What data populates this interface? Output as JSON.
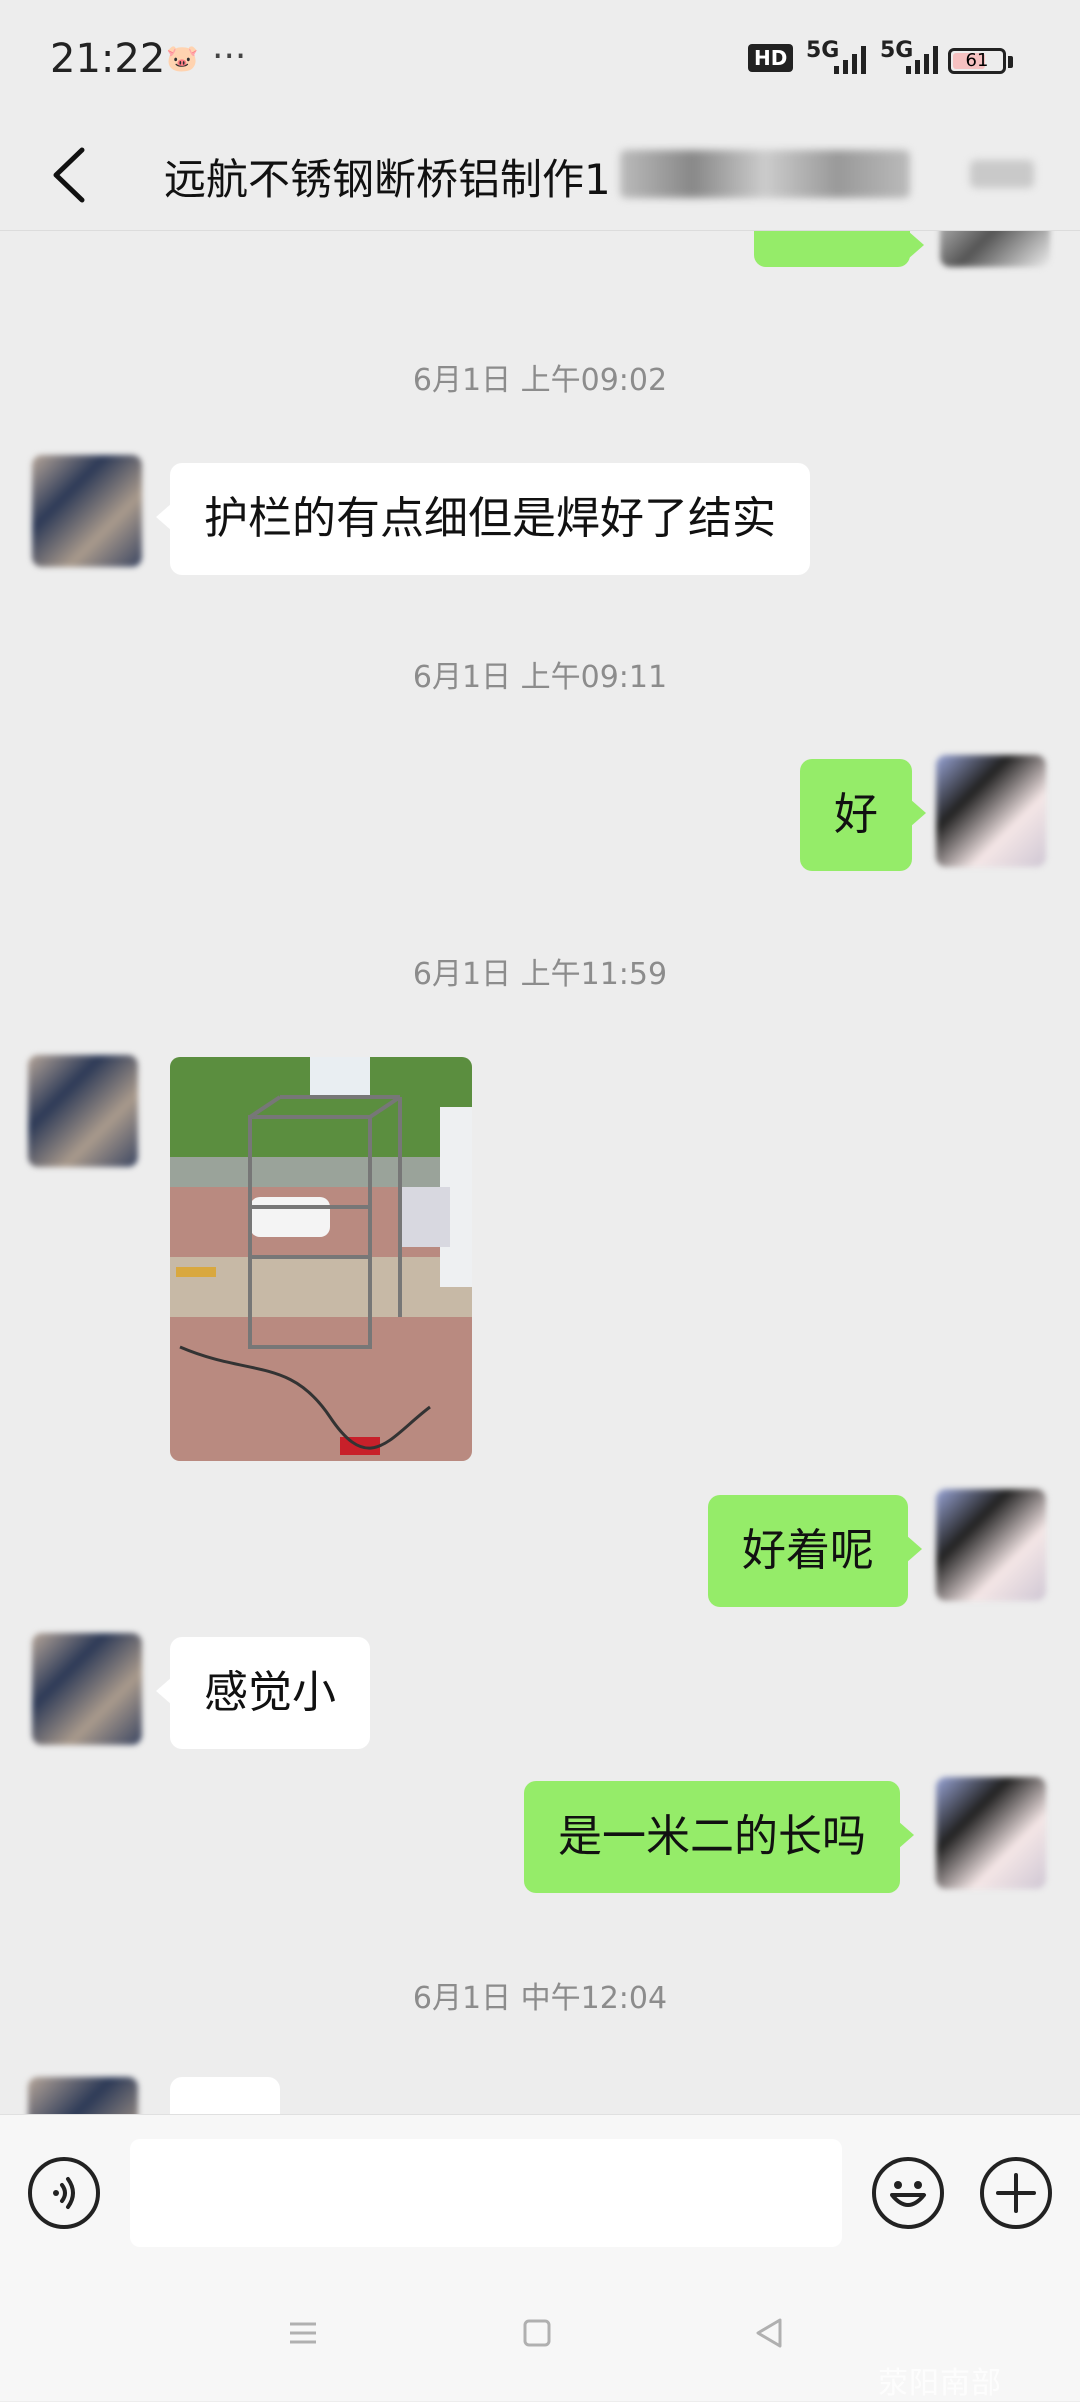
{
  "status_bar": {
    "time": "21:22",
    "hd_label": "HD",
    "net1": "5G",
    "net2": "5G",
    "battery": "61",
    "battery_level": 0.61
  },
  "header": {
    "title": "远航不锈钢断桥铝制作",
    "title_tail_redacted": "1"
  },
  "messages": [
    {
      "type": "timestamp",
      "text": "6月1日 上午09:02"
    },
    {
      "type": "text",
      "side": "in",
      "text": "护栏的有点细但是焊好了结实"
    },
    {
      "type": "timestamp",
      "text": "6月1日 上午09:11"
    },
    {
      "type": "text",
      "side": "out",
      "text": "好"
    },
    {
      "type": "timestamp",
      "text": "6月1日 上午11:59"
    },
    {
      "type": "image",
      "side": "in"
    },
    {
      "type": "text",
      "side": "out",
      "text": "好着呢"
    },
    {
      "type": "text",
      "side": "in",
      "text": "感觉小"
    },
    {
      "type": "text",
      "side": "out",
      "text": "是一米二的长吗"
    },
    {
      "type": "timestamp",
      "text": "6月1日 中午12:04"
    }
  ],
  "watermark": "荥阳南部"
}
